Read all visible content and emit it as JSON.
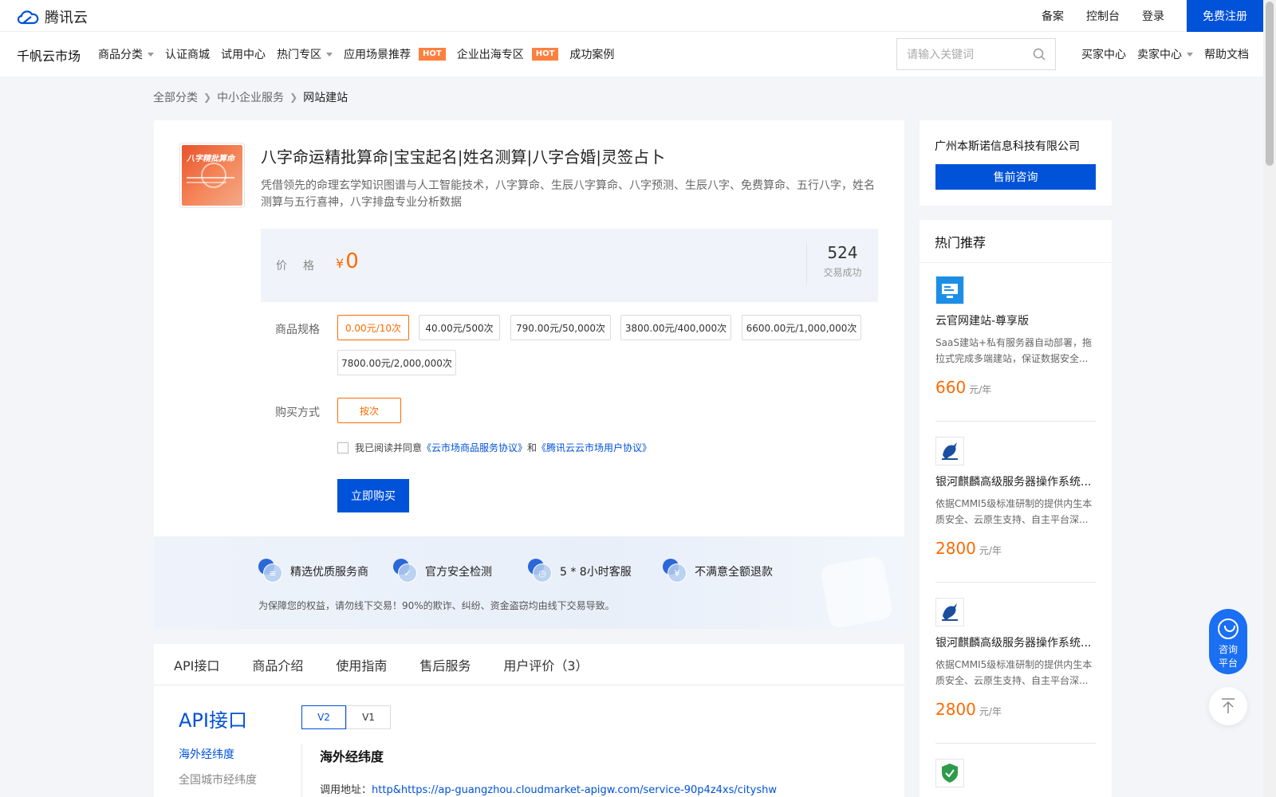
{
  "header": {
    "logo_text": "腾讯云",
    "links": [
      "备案",
      "控制台",
      "登录"
    ],
    "register_label": "免费注册"
  },
  "nav": {
    "brand": "千帆云市场",
    "items": [
      {
        "label": "商品分类",
        "dropdown": true
      },
      {
        "label": "认证商城"
      },
      {
        "label": "试用中心"
      },
      {
        "label": "热门专区",
        "dropdown": true
      },
      {
        "label": "应用场景推荐",
        "badge": "HOT"
      },
      {
        "label": "企业出海专区",
        "badge": "HOT"
      },
      {
        "label": "成功案例"
      }
    ],
    "search_placeholder": "请输入关键词",
    "right_items": [
      {
        "label": "买家中心"
      },
      {
        "label": "卖家中心",
        "dropdown": true
      },
      {
        "label": "帮助文档"
      }
    ]
  },
  "breadcrumb": [
    "全部分类",
    "中小企业服务",
    "网站建站"
  ],
  "product": {
    "image_title": "八字精批算命",
    "title": "八字命运精批算命|宝宝起名|姓名测算|八字合婚|灵签占卜",
    "description": "凭借领先的命理玄学知识图谱与人工智能技术，八字算命、生辰八字算命、八字预测、生辰八字、免费算命、五行八字，姓名测算与五行喜神，八字排盘专业分析数据",
    "price_label": "价格",
    "currency": "¥",
    "price": "0",
    "trade_count": "524",
    "trade_label": "交易成功",
    "spec_label": "商品规格",
    "specs": [
      {
        "label": "0.00元/10次",
        "selected": true
      },
      {
        "label": "40.00元/500次",
        "selected": false
      },
      {
        "label": "790.00元/50,000次",
        "selected": false
      },
      {
        "label": "3800.00元/400,000次",
        "selected": false
      },
      {
        "label": "6600.00元/1,000,000次",
        "selected": false
      },
      {
        "label": "7800.00元/2,000,000次",
        "selected": false
      }
    ],
    "purchase_label": "购买方式",
    "purchase_option": "按次",
    "agree_prefix": "我已阅读并同意",
    "agree_link1": "《云市场商品服务协议》",
    "agree_and": "和",
    "agree_link2": "《腾讯云云市场用户协议》",
    "buy_label": "立即购买"
  },
  "guarantees": {
    "items": [
      {
        "label": "精选优质服务商",
        "icon": "provider-icon"
      },
      {
        "label": "官方安全检测",
        "icon": "security-check-icon"
      },
      {
        "label": "5 * 8小时客服",
        "icon": "clock-icon"
      },
      {
        "label": "不满意全额退款",
        "icon": "refund-icon"
      }
    ],
    "note": "为保障您的权益，请勿线下交易！90%的欺诈、纠纷、资金盗窃均由线下交易导致。"
  },
  "tabs": [
    "API接口",
    "商品介绍",
    "使用指南",
    "售后服务",
    "用户评价（3）"
  ],
  "api": {
    "title": "API接口",
    "versions": [
      {
        "label": "V2",
        "selected": true
      },
      {
        "label": "V1",
        "selected": false
      }
    ],
    "side_links": [
      {
        "label": "海外经纬度",
        "active": true
      },
      {
        "label": "全国城市经纬度",
        "active": false
      }
    ],
    "doc_title": "海外经纬度",
    "url_label": "调用地址：",
    "url": "http&https://ap-guangzhou.cloudmarket-apigw.com/service-90p4z4xs/cityshw"
  },
  "vendor": {
    "name": "广州本斯诺信息科技有限公司",
    "consult_label": "售前咨询"
  },
  "recommend": {
    "title": "热门推荐",
    "items": [
      {
        "name": "云官网建站-尊享版",
        "desc": "SaaS建站+私有服务器自动部署，拖拉式完成多端建站，保证数据安全...",
        "price": "660",
        "unit": "元/年",
        "logo": "website-builder-icon"
      },
      {
        "name": "银河麒麟高级服务器操作系统...",
        "desc": "依据CMMI5级标准研制的提供内生本质安全、云原生支持、自主平台深...",
        "price": "2800",
        "unit": "元/年",
        "logo": "kylin-icon"
      },
      {
        "name": "银河麒麟高级服务器操作系统...",
        "desc": "依据CMMI5级标准研制的提供内生本质安全、云原生支持、自主平台深...",
        "price": "2800",
        "unit": "元/年",
        "logo": "kylin-icon"
      }
    ]
  },
  "float": {
    "consult_line1": "咨询",
    "consult_line2": "平台"
  },
  "colors": {
    "primary": "#0052d9",
    "accent": "#ff6a00",
    "hot_badge": "#ff7f3f"
  }
}
